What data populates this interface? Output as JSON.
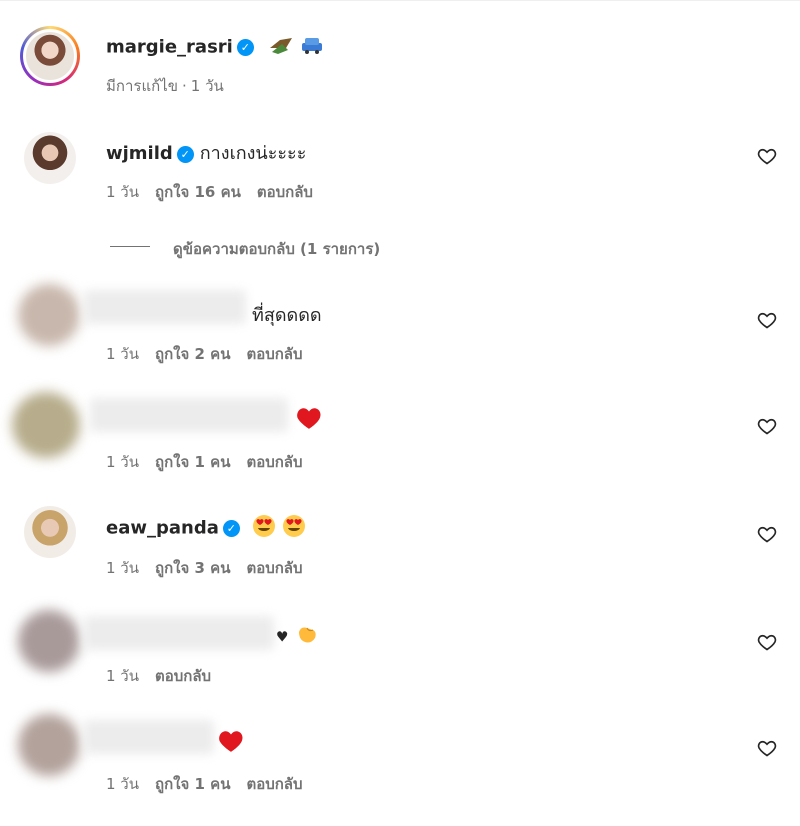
{
  "post": {
    "username": "margie_rasri",
    "verified": true,
    "caption_emojis": [
      "flying-money-icon",
      "car-icon"
    ],
    "edited_label": "มีการแก้ไข",
    "time": "1 วัน"
  },
  "comments": [
    {
      "username": "wjmild",
      "verified": true,
      "text": "กางเกงน่ะะะะ",
      "time": "1 วัน",
      "likes": "ถูกใจ 16 คน",
      "reply": "ตอบกลับ"
    },
    {
      "username": "",
      "text": "ที่สุดดดด",
      "time": "1 วัน",
      "likes": "ถูกใจ 2 คน",
      "reply": "ตอบกลับ"
    },
    {
      "username": "",
      "text": "",
      "emoji": "red-heart-icon",
      "time": "1 วัน",
      "likes": "ถูกใจ 1 คน",
      "reply": "ตอบกลับ"
    },
    {
      "username": "eaw_panda",
      "verified": true,
      "emoji": "heart-eyes-icon",
      "time": "1 วัน",
      "likes": "ถูกใจ 3 คน",
      "reply": "ตอบกลับ"
    },
    {
      "username": "",
      "text": "♥",
      "emoji": "pinching-hand-icon",
      "time": "1 วัน",
      "reply": "ตอบกลับ"
    },
    {
      "username": "",
      "emoji": "red-heart-icon",
      "time": "1 วัน",
      "likes": "ถูกใจ 1 คน",
      "reply": "ตอบกลับ"
    }
  ],
  "view_replies": "ดูข้อความตอบกลับ (1 รายการ)",
  "colors": {
    "verified": "#0095f6",
    "meta": "#737373",
    "heart": "#e0171e"
  }
}
